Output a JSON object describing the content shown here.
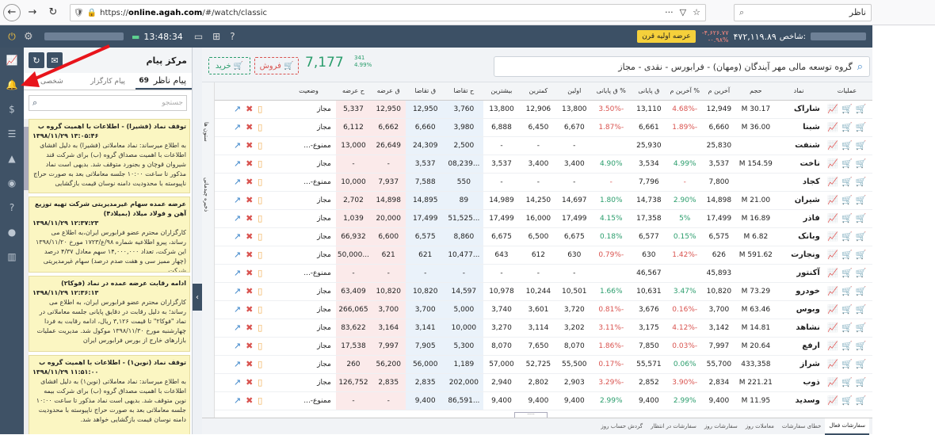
{
  "browser": {
    "url_protocol": "https://",
    "url_domain": "online.agah.com",
    "url_path": "/#/watch/classic",
    "search_text": "ناظر"
  },
  "topbar": {
    "time": "13:48:34",
    "index_label": "شاخص:",
    "index_value": "۴۷۲,۱۱۹.۸۹",
    "index_change": "-۴,۶۲۶.۷۷",
    "index_change_pct": "-۰.۹۸%",
    "ipo_button": "عرضه اولیه قرن"
  },
  "messages": {
    "title": "مرکز پیام",
    "tabs": [
      {
        "label": "پیام ناظر",
        "count": "69"
      },
      {
        "label": "پیام کارگزار"
      },
      {
        "label": "شخصی"
      }
    ],
    "search_placeholder": "جستجو",
    "items": [
      {
        "title": "توقف نماد (فشیرا) - اطلاعات با اهمیت گروه ب",
        "date": "۱۳۹۸/۱۱/۲۹ ۱۳:۰۵:۴۶",
        "body": "به اطلاع میرساند: نماد معاملاتی (فشیرا) به دلیل افشای اطلاعات با اهمیت مصداق گروه (ب) برای شرکت قند شیروان قوچان و بجنورد متوقف شد. بدیهی است نماد مذکور تا ساعت ۱۰:۰۰ جلسه معاملاتی بعد به صورت حراج ناپیوسته با محدودیت دامنه نوسان قیمت بازگشایی"
      },
      {
        "title": "عرضه عمده سهام غیرمدیریتی شرکت تهیه توزیع آهن و فولاد میلاد (بمیلاد۴)",
        "date": "۱۳۹۸/۱۱/۲۹ ۱۲:۳۷:۲۳",
        "body": "کارگزاران محترم عضو فرابورس ایران،به اطلاع می رساند، پیرو اطلاعیه شماره ۹۸/ع/۱۷۲۳ مورخ ۱۳۹۸/۱۱/۲۰ این شرکت، تعداد ۱۴,۰۰۰,۰۰۰ سهم معادل ۴/۳۷ درصد (چهار ممیز سی و هفت صدم درصد) سهام غیرمدیریتی شرکت"
      },
      {
        "title": "ادامه رقابت عرضه عمده در نماد (فوکا۲)",
        "date": "۱۳۹۸/۱۱/۲۹ ۱۲:۳۶:۱۳",
        "body": "کارگزاران محترم عضو فرابورس ایران، به اطلاع می رساند؛ به دلیل رقابت در دقایق پایانی جلسه معاملاتی در نماد \"فوکا۲\" تا قیمت ۳,۱۲۶ ریال، ادامه رقابت به فردا چهارشنبه مورخ ۱۳۹۸/۱۱/۳۰ موکول شد. مدیریت عملیات بازارهای خارج از بورس فرابورس ایران"
      },
      {
        "title": "توقف نماد (نوین۱) - اطلاعات با اهمیت گروه ب",
        "date": "۱۳۹۸/۱۱/۲۹ ۱۱:۵۱:۰۰",
        "body": "به اطلاع میرساند: نماد معاملاتی (نوین۱) به دلیل افشای اطلاعات با اهمیت مصداق گروه (ب) برای شرکت بیمه نوین متوقف شد. بدیهی است نماد مذکور تا ساعت ۱۰:۰۰ جلسه معاملاتی بعد به صورت حراج ناپیوسته با محدودیت دامنه نوسان قیمت بازگشایی خواهد شد."
      }
    ]
  },
  "symbol_bar": {
    "buy_label": "خرید",
    "sell_label": "فروش",
    "last_price": "7,177",
    "change": "341",
    "change_pct": "4.99%",
    "search_text": "گروه توسعه مالی مهر آیندگان (ومهان) - فرابورس - نقدی - مجاز"
  },
  "side_tabs": {
    "columns": "ستون ها",
    "saved": "ذخیره چیدمانی"
  },
  "table": {
    "headers": [
      "عملیات",
      "نماد",
      "حجم",
      "آخرین م",
      "% آخرین م",
      "ق پایانی",
      "% ق پایانی",
      "اولین",
      "کمترین",
      "بیشترین",
      "ح تقاضا",
      "ق تقاضا",
      "ق عرضه",
      "ح عرضه",
      "وضعیت",
      ""
    ],
    "rows": [
      [
        "شاراک",
        "30.17 M",
        "12,949",
        "-4.68%",
        "13,110",
        "-3.50%",
        "13,800",
        "12,906",
        "13,800",
        "3,760",
        "12,950",
        "12,950",
        "5,337",
        "مجاز"
      ],
      [
        "شبنا",
        "36.00 M",
        "6,660",
        "-1.89%",
        "6,661",
        "-1.87%",
        "6,670",
        "6,450",
        "6,888",
        "3,980",
        "6,660",
        "6,662",
        "6,112",
        "مجاز"
      ],
      [
        "شنفت",
        "",
        "25,830",
        "",
        "25,930",
        "",
        "-",
        "-",
        "-",
        "2,500",
        "24,309",
        "26,649",
        "13,000",
        "ممنوع-..."
      ],
      [
        "ناخت",
        "154.59 M",
        "3,537",
        "4.99%",
        "3,534",
        "4.90%",
        "3,400",
        "3,400",
        "3,537",
        "...08,239",
        "3,537",
        "-",
        "-",
        "مجاز"
      ],
      [
        "کجاد",
        "",
        "7,800",
        "-",
        "7,796",
        "-",
        "-",
        "-",
        "-",
        "550",
        "7,588",
        "7,937",
        "10,000",
        "ممنوع-..."
      ],
      [
        "شیران",
        "21.00 M",
        "14,898",
        "2.90%",
        "14,738",
        "1.80%",
        "14,697",
        "14,250",
        "14,989",
        "89",
        "14,895",
        "14,898",
        "2,702",
        "مجاز"
      ],
      [
        "فاذر",
        "16.89 M",
        "17,499",
        "5%",
        "17,358",
        "4.15%",
        "17,499",
        "16,000",
        "17,499",
        "...51,525",
        "17,499",
        "20,000",
        "1,039",
        "مجاز"
      ],
      [
        "وبانک",
        "6.82 M",
        "6,575",
        "0.15%",
        "6,577",
        "0.18%",
        "6,675",
        "6,500",
        "6,675",
        "8,860",
        "6,575",
        "6,600",
        "66,932",
        "مجاز"
      ],
      [
        "ونجارت",
        "591.62 M",
        "626",
        "-1.42%",
        "630",
        "-0.79%",
        "630",
        "612",
        "643",
        "...10,477",
        "621",
        "621",
        "...50,000",
        "مجاز"
      ],
      [
        "آکنتور",
        "",
        "45,893",
        "",
        "46,567",
        "",
        "-",
        "-",
        "-",
        "-",
        "-",
        "-",
        "-",
        "ممنوع-..."
      ],
      [
        "خودرو",
        "73.29 M",
        "10,820",
        "3.47%",
        "10,631",
        "1.66%",
        "10,501",
        "10,244",
        "10,978",
        "14,597",
        "10,820",
        "10,820",
        "63,409",
        "مجاز"
      ],
      [
        "وبوس",
        "63.46 M",
        "3,700",
        "-0.16%",
        "3,676",
        "-0.81%",
        "3,720",
        "3,601",
        "3,740",
        "5,000",
        "3,700",
        "3,700",
        "266,065",
        "مجاز"
      ],
      [
        "نشاهد",
        "14.81 M",
        "3,142",
        "-4.12%",
        "3,175",
        "-3.11%",
        "3,202",
        "3,114",
        "3,270",
        "10,000",
        "3,141",
        "3,164",
        "83,622",
        "مجاز"
      ],
      [
        "ارفع",
        "20.64 M",
        "7,997",
        "-0.03%",
        "7,850",
        "-1.86%",
        "8,070",
        "7,650",
        "8,070",
        "5,300",
        "7,905",
        "7,997",
        "17,538",
        "مجاز"
      ],
      [
        "شراز",
        "433,358",
        "55,700",
        "0.06%",
        "55,571",
        "-0.17%",
        "55,500",
        "52,725",
        "57,000",
        "1,189",
        "56,000",
        "56,200",
        "260",
        "مجاز"
      ],
      [
        "ذوب",
        "221.21 M",
        "2,834",
        "-3.90%",
        "2,852",
        "-3.29%",
        "2,903",
        "2,802",
        "2,940",
        "202,000",
        "2,835",
        "2,835",
        "126,752",
        "مجاز"
      ],
      [
        "وسدید",
        "11.95 M",
        "9,400",
        "2.99%",
        "9,400",
        "2.99%",
        "9,400",
        "9,400",
        "9,400",
        "...86,591",
        "9,400",
        "-",
        "-",
        "ممنوع-..."
      ]
    ]
  },
  "bottom_tabs": [
    "سفارشات فعال",
    "خطای سفارشات",
    "معاملات روز",
    "سفارشات روز",
    "سفارشات در انتظار",
    "گردش حساب روز"
  ],
  "colors": {
    "buy": "#2a9d6c",
    "sell": "#d9534f",
    "nav": "#3c5065",
    "message_bg": "#fbf6c2"
  }
}
